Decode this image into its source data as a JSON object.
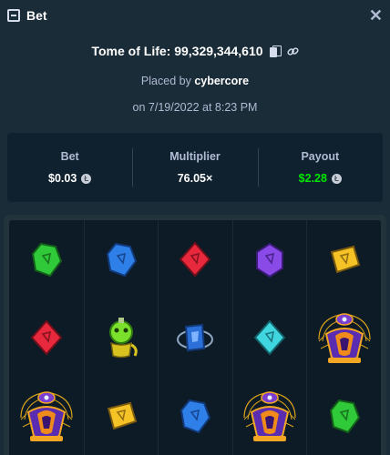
{
  "header": {
    "title": "Bet",
    "ticket_icon": "ticket-icon",
    "close_label": "✕"
  },
  "game": {
    "name_line": "Tome of Life: 99,329,344,610",
    "copy_icon": "copy-icon",
    "link_icon": "link-icon"
  },
  "placed": {
    "prefix": "Placed by",
    "user": "cybercore"
  },
  "date": "on 7/19/2022 at 8:23 PM",
  "stats": {
    "bet": {
      "label": "Bet",
      "value": "$0.03"
    },
    "multiplier": {
      "label": "Multiplier",
      "value": "76.05×"
    },
    "payout": {
      "label": "Payout",
      "value": "$2.28",
      "color": "#00e701"
    },
    "coin_icon": "litecoin-icon"
  },
  "board": {
    "columns": [
      [
        "green-gem",
        "red-gem",
        "scarab-wild"
      ],
      [
        "blue-gem",
        "potion-symbol",
        "yellow-gem"
      ],
      [
        "red-gem",
        "blue-orb-symbol",
        "blue-gem"
      ],
      [
        "purple-gem",
        "teal-gem",
        "scarab-wild"
      ],
      [
        "yellow-gem",
        "scarab-wild",
        "green-gem"
      ]
    ]
  },
  "colors": {
    "background": "#1a2c38",
    "panel": "#0f212e",
    "accent_green": "#00e701"
  }
}
